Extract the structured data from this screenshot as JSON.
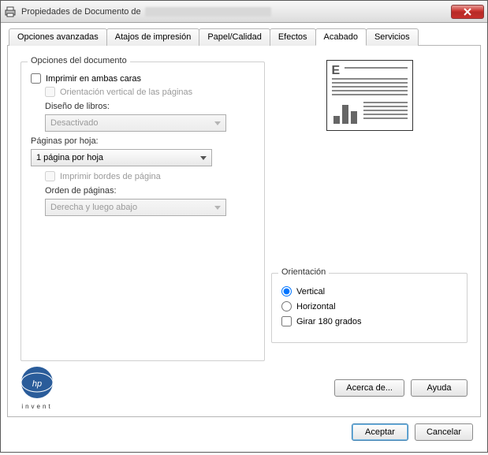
{
  "window": {
    "title_prefix": "Propiedades de Documento de "
  },
  "tabs": {
    "advanced": "Opciones avanzadas",
    "shortcuts": "Atajos de impresión",
    "paper": "Papel/Calidad",
    "effects": "Efectos",
    "finishing": "Acabado",
    "services": "Servicios"
  },
  "doc_options": {
    "legend": "Opciones del documento",
    "print_both_sides": "Imprimir en ambas caras",
    "flip_pages_up": "Orientación vertical de las páginas",
    "booklet_layout_label": "Diseño de libros:",
    "booklet_layout_value": "Desactivado",
    "pages_per_sheet_label": "Páginas por hoja:",
    "pages_per_sheet_value": "1 página por hoja",
    "print_page_borders": "Imprimir bordes de página",
    "page_order_label": "Orden de páginas:",
    "page_order_value": "Derecha y luego abajo"
  },
  "orientation": {
    "legend": "Orientación",
    "portrait": "Vertical",
    "landscape": "Horizontal",
    "rotate180": "Girar 180 grados"
  },
  "logo": {
    "text": "invent"
  },
  "buttons": {
    "about": "Acerca de...",
    "help": "Ayuda",
    "ok": "Aceptar",
    "cancel": "Cancelar"
  }
}
